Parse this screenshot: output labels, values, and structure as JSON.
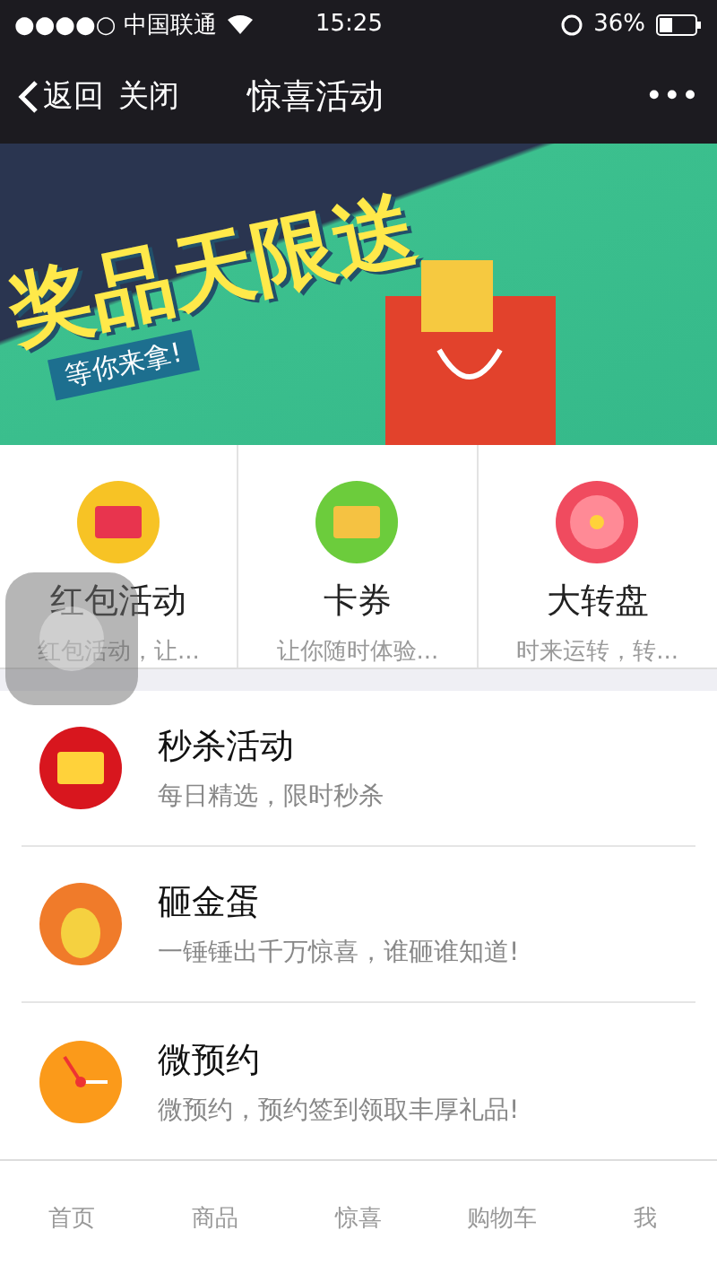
{
  "status_bar": {
    "carrier": "●●●●○ 中国联通",
    "time": "15:25",
    "battery": "36%"
  },
  "nav": {
    "back": "返回",
    "close": "关闭",
    "title": "惊喜活动",
    "more": "•••"
  },
  "banner": {
    "headline": "奖品天限送",
    "tagline": "等你来拿!"
  },
  "grid": [
    {
      "kind": "redpacket",
      "title": "红包活动",
      "subtitle": "红包活动，让..."
    },
    {
      "kind": "coupon",
      "title": "卡券",
      "subtitle": "让你随时体验..."
    },
    {
      "kind": "wheel",
      "title": "大转盘",
      "subtitle": "时来运转，转..."
    }
  ],
  "list": [
    {
      "kind": "flash",
      "title": "秒杀活动",
      "subtitle": "每日精选，限时秒杀"
    },
    {
      "kind": "egg",
      "title": "砸金蛋",
      "subtitle": "一锤锤出千万惊喜，谁砸谁知道!"
    },
    {
      "kind": "clock",
      "title": "微预约",
      "subtitle": "微预约，预约签到领取丰厚礼品!"
    }
  ],
  "tabbar": [
    {
      "label": "首页",
      "selected": false
    },
    {
      "label": "商品",
      "selected": false
    },
    {
      "label": "惊喜",
      "selected": false
    },
    {
      "label": "购物车",
      "selected": false
    },
    {
      "label": "我",
      "selected": false
    }
  ]
}
